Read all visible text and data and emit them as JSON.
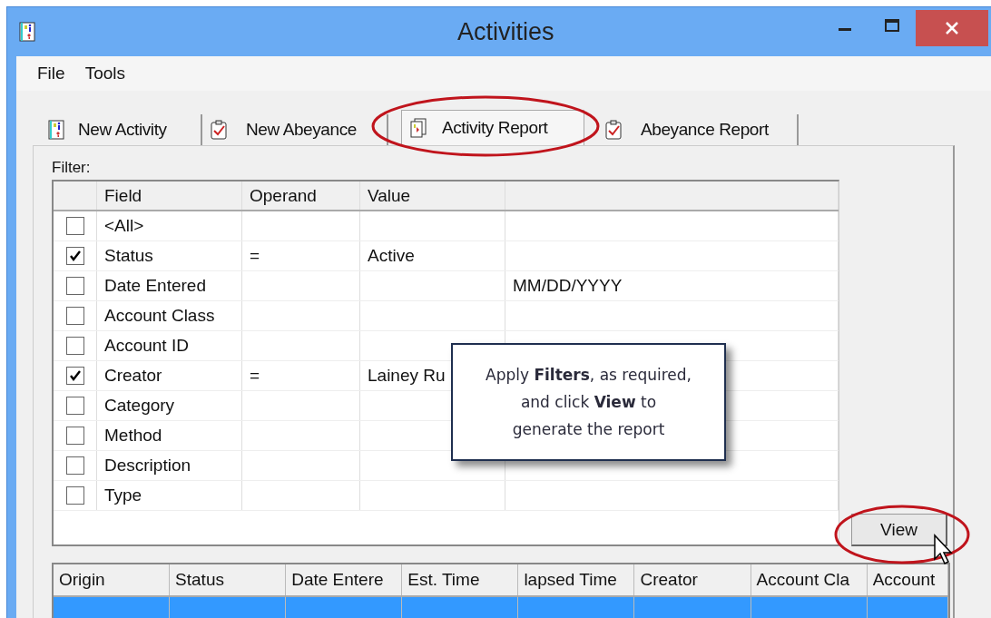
{
  "window": {
    "title": "Activities"
  },
  "menu": [
    "File",
    "Tools"
  ],
  "tabs": [
    {
      "label": "New Activity",
      "kind": "notebook",
      "selected": false
    },
    {
      "label": "New Abeyance",
      "kind": "clipboard",
      "selected": false
    },
    {
      "label": "Activity Report",
      "kind": "report",
      "selected": true
    },
    {
      "label": "Abeyance Report",
      "kind": "clipboard",
      "selected": false
    }
  ],
  "filter": {
    "label": "Filter:",
    "columns": [
      "Field",
      "Operand",
      "Value"
    ],
    "rows": [
      {
        "checked": false,
        "field": "<All>"
      },
      {
        "checked": true,
        "field": "Status",
        "operand": "=",
        "value": "Active"
      },
      {
        "checked": false,
        "field": "Date Entered",
        "column_5": "MM/DD/YYYY"
      },
      {
        "checked": false,
        "field": "Account Class"
      },
      {
        "checked": false,
        "field": "Account ID"
      },
      {
        "checked": true,
        "field": "Creator",
        "operand": "=",
        "value": "Lainey Ru"
      },
      {
        "checked": false,
        "field": "Category"
      },
      {
        "checked": false,
        "field": "Method"
      },
      {
        "checked": false,
        "field": "Description"
      },
      {
        "checked": false,
        "field": "Type"
      }
    ]
  },
  "view_button": "View",
  "results": {
    "columns": [
      "Origin",
      "Status",
      "Date Entere",
      "Est. Time",
      "lapsed Time",
      "Creator",
      "Account Cla",
      "Account"
    ]
  },
  "callout": "Apply **Filters**, as required, and click **View** to generate the report"
}
